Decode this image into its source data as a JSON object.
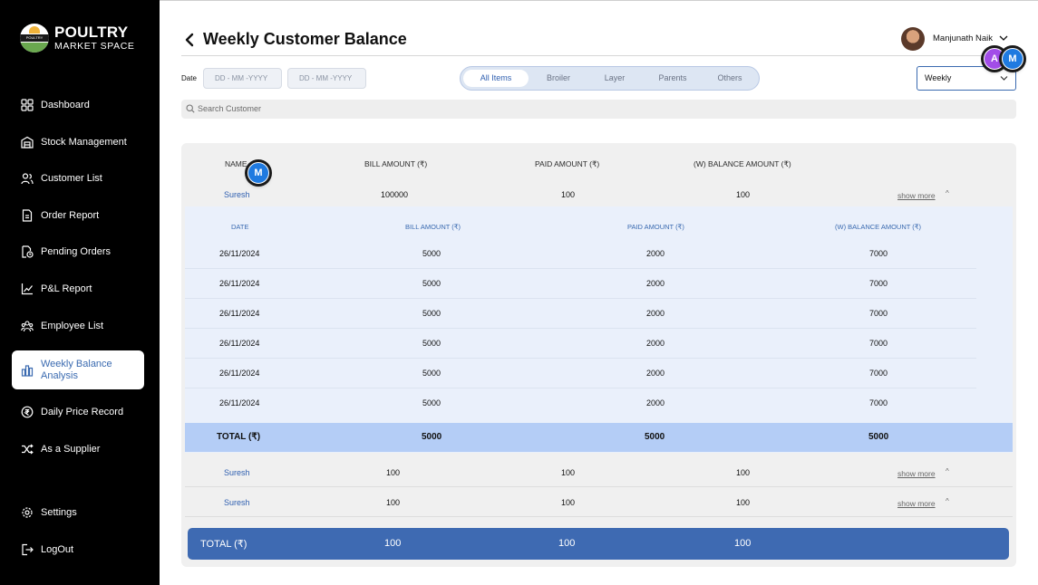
{
  "brand": {
    "line1": "POULTRY",
    "line2": "MARKET SPACE",
    "badge_text": "POULTRY"
  },
  "sidebar": {
    "items": [
      {
        "label": "Dashboard",
        "icon": "grid-icon"
      },
      {
        "label": "Stock Management",
        "icon": "warehouse-icon"
      },
      {
        "label": "Customer List",
        "icon": "users-icon"
      },
      {
        "label": "Order Report",
        "icon": "document-icon"
      },
      {
        "label": "Pending Orders",
        "icon": "pending-doc-icon"
      },
      {
        "label": "P&L Report",
        "icon": "chart-line-icon"
      },
      {
        "label": "Employee List",
        "icon": "team-icon"
      },
      {
        "label": "Weekly Balance Analysis",
        "icon": "bar-chart-icon"
      },
      {
        "label": "Daily Price Record",
        "icon": "currency-icon"
      },
      {
        "label": "As a Supplier",
        "icon": "shuffle-icon"
      }
    ],
    "active_index": 7,
    "settings_label": "Settings",
    "logout_label": "LogOut"
  },
  "header": {
    "title": "Weekly Customer Balance",
    "user_name": "Manjunath Naik"
  },
  "filters": {
    "date_label": "Date",
    "date_from_placeholder": "DD - MM -YYYY",
    "date_to_placeholder": "DD - MM -YYYY",
    "tabs": [
      "All Items",
      "Broiler",
      "Layer",
      "Parents",
      "Others"
    ],
    "active_tab": "All Items",
    "period_select": "Weekly"
  },
  "search": {
    "placeholder": "Search Customer"
  },
  "table": {
    "headers": [
      "NAME",
      "BILL AMOUNT (₹)",
      "PAID AMOUNT (₹)",
      "(W) BALANCE AMOUNT (₹)"
    ],
    "show_more_label": "show more",
    "rows": [
      {
        "name": "Suresh",
        "bill": "100000",
        "paid": "100",
        "balance": "100"
      },
      {
        "name": "Suresh",
        "bill": "100",
        "paid": "100",
        "balance": "100"
      },
      {
        "name": "Suresh",
        "bill": "100",
        "paid": "100",
        "balance": "100"
      }
    ],
    "expanded": {
      "headers": [
        "DATE",
        "BILL AMOUNT (₹)",
        "PAID AMOUNT (₹)",
        "(W) BALANCE AMOUNT (₹)"
      ],
      "rows": [
        {
          "date": "26/11/2024",
          "bill": "5000",
          "paid": "2000",
          "balance": "7000"
        },
        {
          "date": "26/11/2024",
          "bill": "5000",
          "paid": "2000",
          "balance": "7000"
        },
        {
          "date": "26/11/2024",
          "bill": "5000",
          "paid": "2000",
          "balance": "7000"
        },
        {
          "date": "26/11/2024",
          "bill": "5000",
          "paid": "2000",
          "balance": "7000"
        },
        {
          "date": "26/11/2024",
          "bill": "5000",
          "paid": "2000",
          "balance": "7000"
        },
        {
          "date": "26/11/2024",
          "bill": "5000",
          "paid": "2000",
          "balance": "7000"
        }
      ],
      "total": {
        "label": "TOTAL (₹)",
        "bill": "5000",
        "paid": "5000",
        "balance": "5000"
      }
    },
    "grand_total": {
      "label": "TOTAL (₹)",
      "bill": "100",
      "paid": "100",
      "balance": "100"
    }
  },
  "overlays": {
    "bubble_a": "A",
    "bubble_m": "M"
  },
  "colors": {
    "accent": "#3e6ab2",
    "link": "#2f5fb0",
    "sidebar_bg": "#000000",
    "subtotal_bg": "#b4cdf6"
  }
}
